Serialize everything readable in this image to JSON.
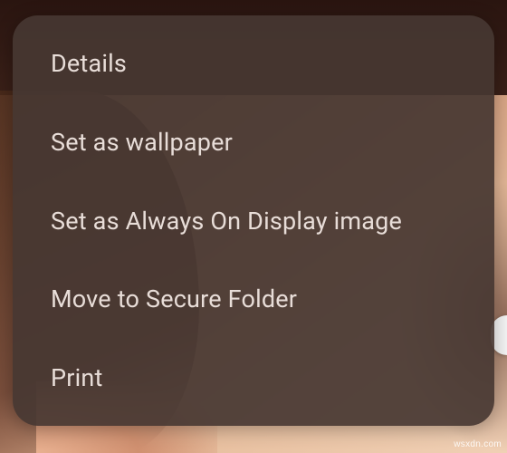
{
  "menu": {
    "items": [
      {
        "label": "Details"
      },
      {
        "label": "Set as wallpaper"
      },
      {
        "label": "Set as Always On Display image"
      },
      {
        "label": "Move to Secure Folder"
      },
      {
        "label": "Print"
      }
    ]
  },
  "watermark": "wsxdn.com"
}
